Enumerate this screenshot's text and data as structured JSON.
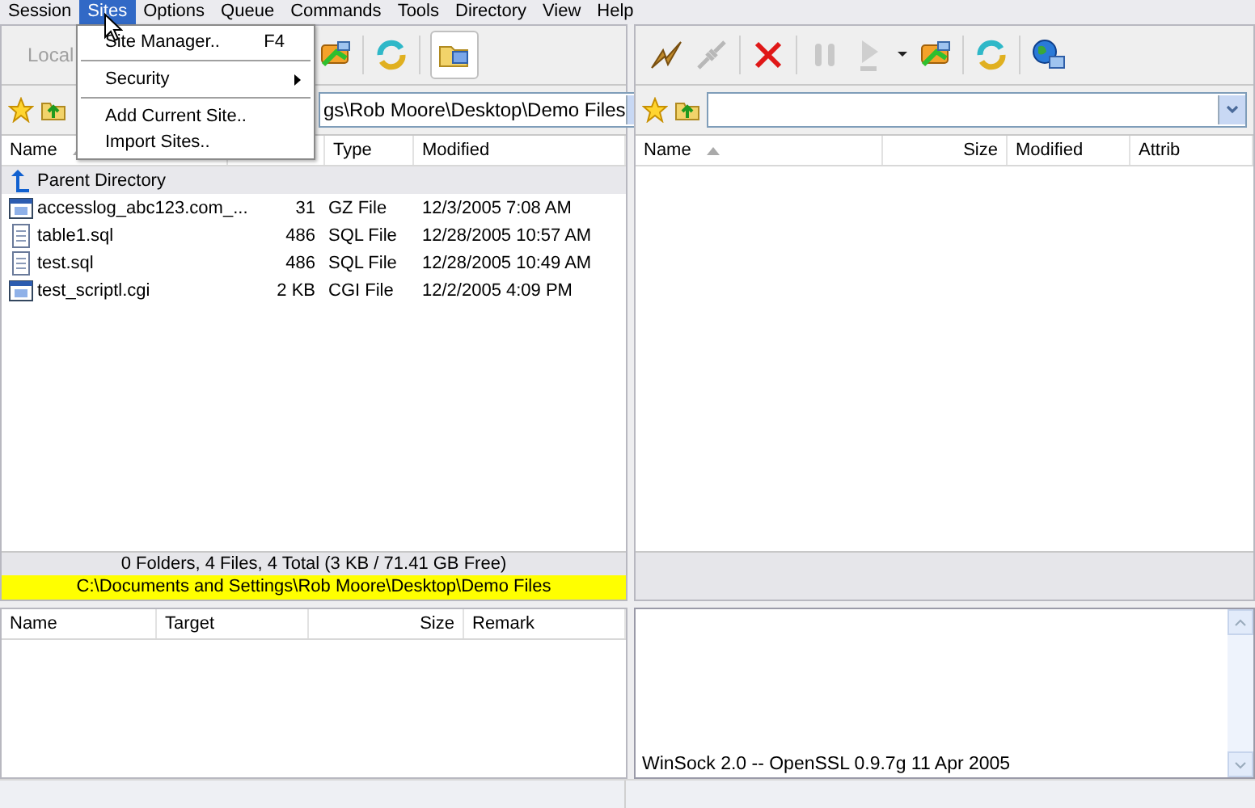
{
  "menubar": [
    {
      "label": "Session",
      "selected": false
    },
    {
      "label": "Sites",
      "selected": true
    },
    {
      "label": "Options",
      "selected": false
    },
    {
      "label": "Queue",
      "selected": false
    },
    {
      "label": "Commands",
      "selected": false
    },
    {
      "label": "Tools",
      "selected": false
    },
    {
      "label": "Directory",
      "selected": false
    },
    {
      "label": "View",
      "selected": false
    },
    {
      "label": "Help",
      "selected": false
    }
  ],
  "sites_menu": [
    {
      "kind": "item",
      "label": "Site Manager..",
      "shortcut": "F4"
    },
    {
      "kind": "separator"
    },
    {
      "kind": "submenu",
      "label": "Security"
    },
    {
      "kind": "separator"
    },
    {
      "kind": "item",
      "label": "Add Current Site.."
    },
    {
      "kind": "item",
      "label": "Import Sites.."
    }
  ],
  "local_pane": {
    "toolbar_label": "Local",
    "path": "gs\\Rob Moore\\Desktop\\Demo Files",
    "columns": [
      {
        "label": "Name",
        "sorted": true
      },
      {
        "label": "Type",
        "sorted": false
      },
      {
        "label": "Modified",
        "sorted": false
      }
    ],
    "parent_row": "Parent Directory",
    "rows": [
      {
        "name": "accesslog_abc123.com_...",
        "size": "31",
        "type": "GZ File",
        "modified": "12/3/2005 7:08 AM",
        "kind": "app"
      },
      {
        "name": "table1.sql",
        "size": "486",
        "type": "SQL File",
        "modified": "12/28/2005 10:57 AM",
        "kind": "text"
      },
      {
        "name": "test.sql",
        "size": "486",
        "type": "SQL File",
        "modified": "12/28/2005 10:49 AM",
        "kind": "text"
      },
      {
        "name": "test_scriptl.cgi",
        "size": "2 KB",
        "type": "CGI File",
        "modified": "12/2/2005 4:09 PM",
        "kind": "app"
      }
    ],
    "summary": "0 Folders, 4 Files, 4 Total (3 KB / 71.41 GB Free)",
    "current_path": "C:\\Documents and Settings\\Rob Moore\\Desktop\\Demo Files"
  },
  "remote_pane": {
    "columns": [
      {
        "label": "Name",
        "kind": "text",
        "sorted": true
      },
      {
        "label": "Size",
        "kind": "number",
        "sorted": false
      },
      {
        "label": "Modified",
        "kind": "text",
        "sorted": false
      },
      {
        "label": "Attrib",
        "kind": "text",
        "sorted": false
      }
    ]
  },
  "queue": {
    "columns": [
      {
        "label": "Name",
        "kind": "text"
      },
      {
        "label": "Target",
        "kind": "text"
      },
      {
        "label": "Size",
        "kind": "number"
      },
      {
        "label": "Remark",
        "kind": "text"
      }
    ]
  },
  "log": {
    "lines": [
      "WinSock 2.0 -- OpenSSL 0.9.7g 11 Apr 2005"
    ]
  }
}
